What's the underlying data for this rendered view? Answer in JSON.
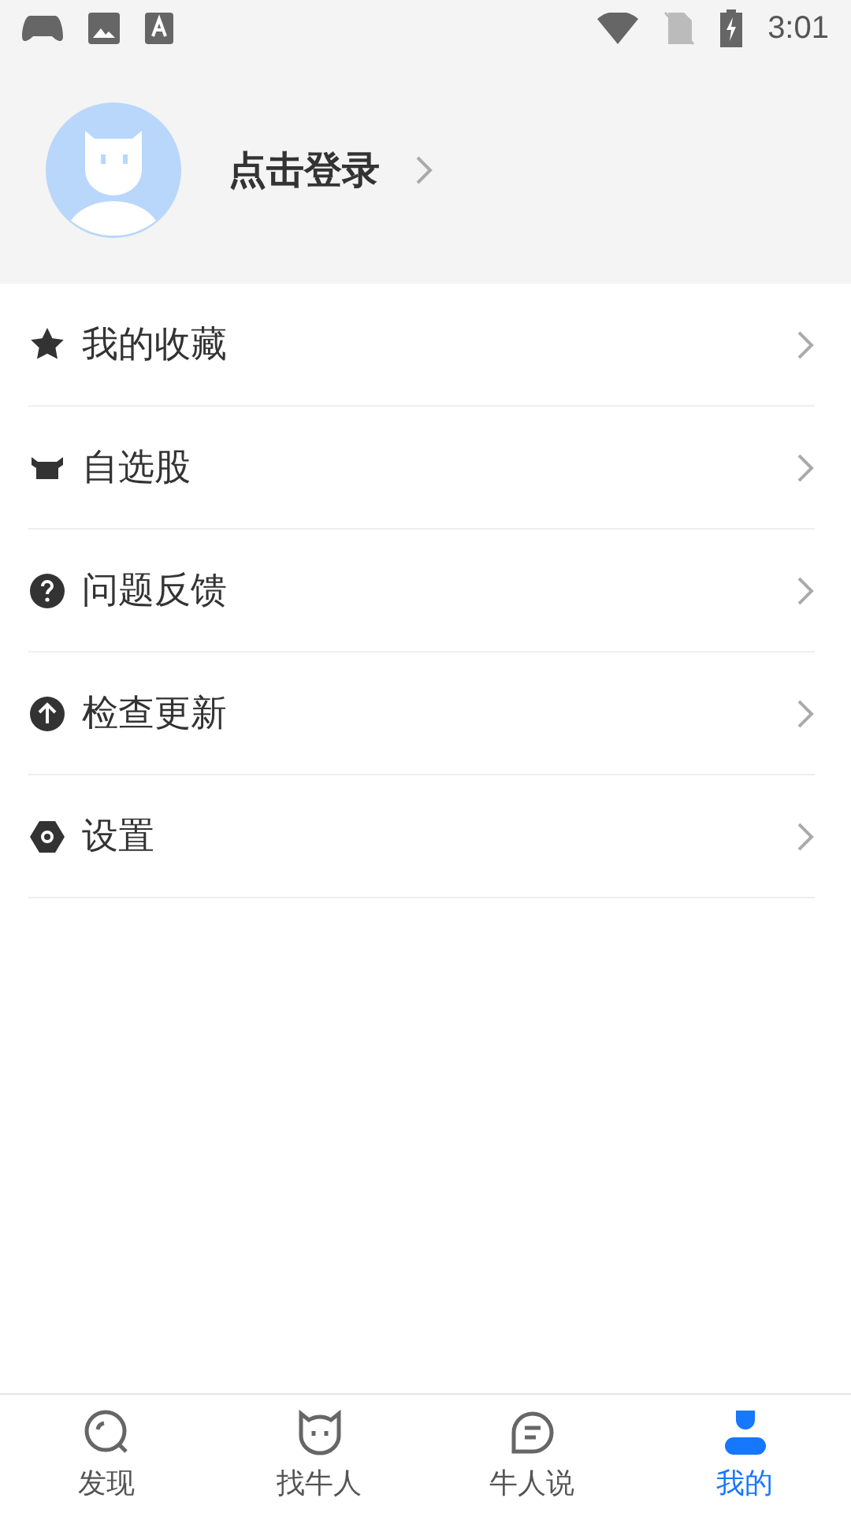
{
  "status_bar": {
    "time": "3:01"
  },
  "profile": {
    "login_label": "点击登录"
  },
  "menu": [
    {
      "kind": "star",
      "label": "我的收藏"
    },
    {
      "kind": "bull",
      "label": "自选股"
    },
    {
      "kind": "help",
      "label": "问题反馈"
    },
    {
      "kind": "update",
      "label": "检查更新"
    },
    {
      "kind": "settings",
      "label": "设置"
    }
  ],
  "bottom_nav": [
    {
      "kind": "discover",
      "label": "发现",
      "selected": false
    },
    {
      "kind": "cat",
      "label": "找牛人",
      "selected": false
    },
    {
      "kind": "chat",
      "label": "牛人说",
      "selected": false
    },
    {
      "kind": "me",
      "label": "我的",
      "selected": true
    }
  ]
}
